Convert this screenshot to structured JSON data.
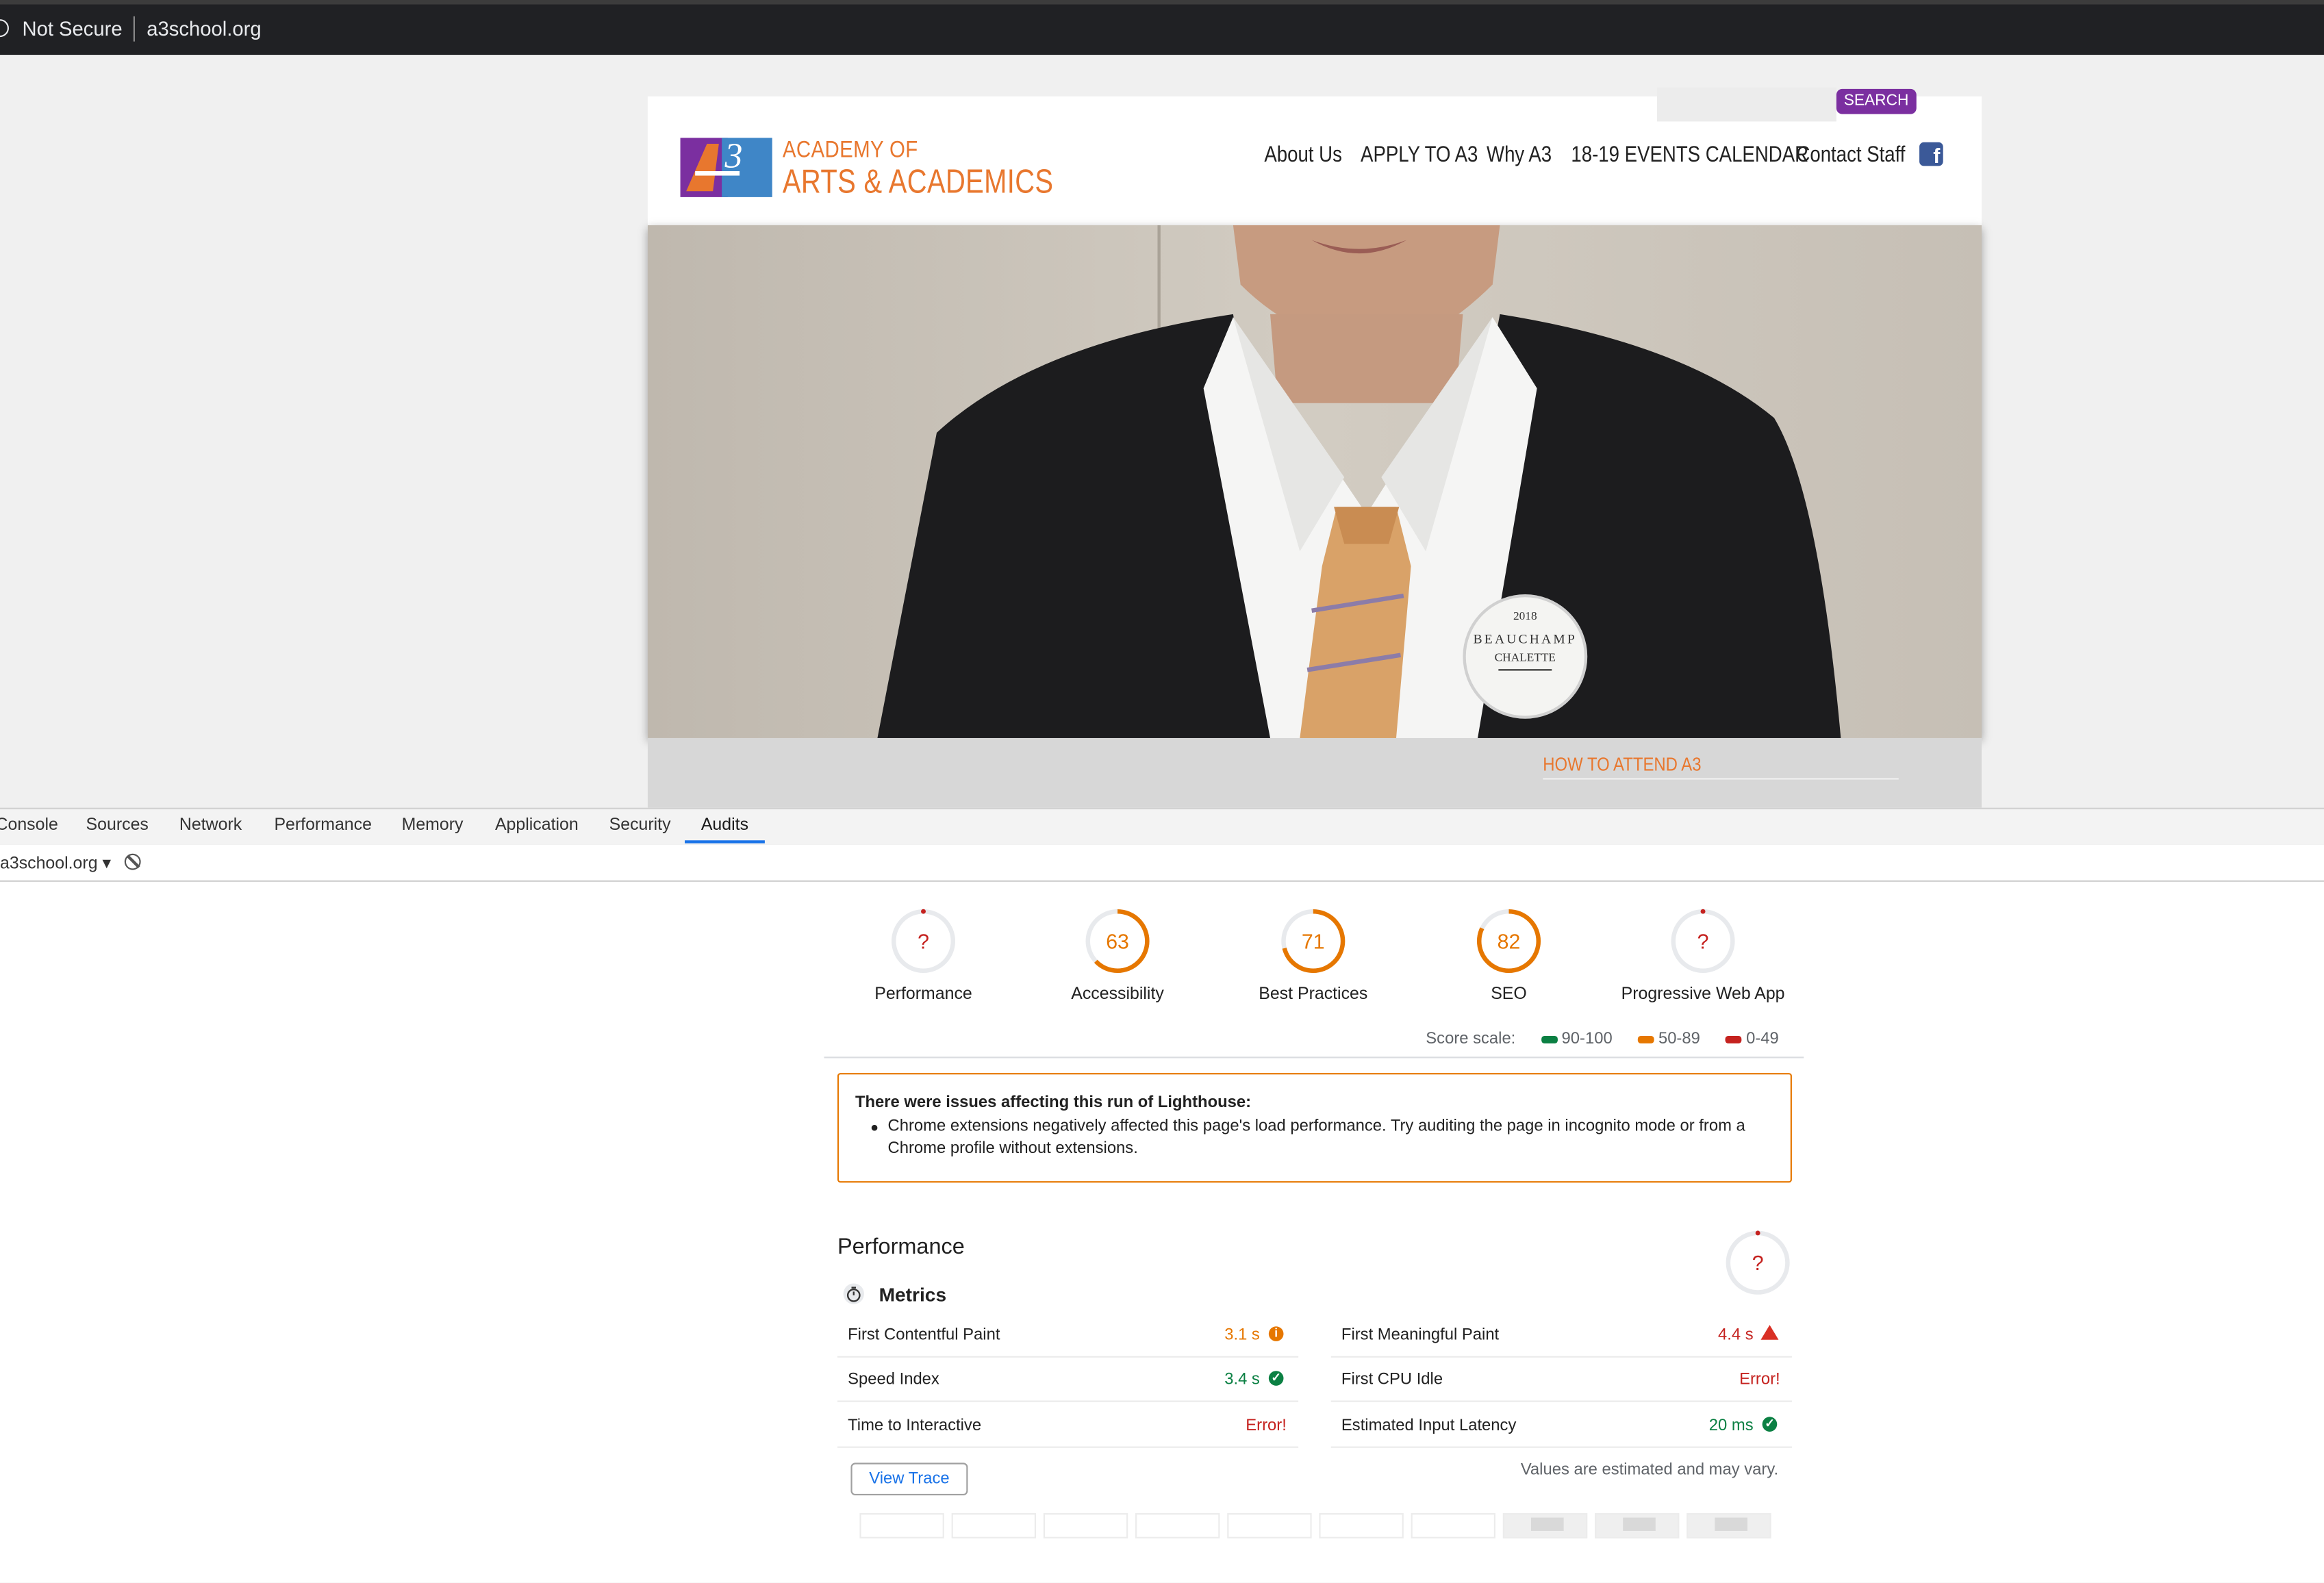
{
  "browser": {
    "security_label": "Not Secure",
    "url": "a3school.org"
  },
  "site": {
    "search_button": "SEARCH",
    "logo_line1": "ACADEMY OF",
    "logo_line2": "ARTS & ACADEMICS",
    "nav": [
      "About Us",
      "APPLY TO A3",
      "Why A3",
      "18-19 EVENTS CALENDAR",
      "Contact Staff"
    ],
    "badge_year": "2018",
    "badge_line1": "BEAUCHAMP",
    "badge_line2": "CHALETTE",
    "how_to_attend": "HOW TO ATTEND A3"
  },
  "devtools": {
    "tabs": [
      "Console",
      "Sources",
      "Network",
      "Performance",
      "Memory",
      "Application",
      "Security",
      "Audits"
    ],
    "active_tab": "Audits",
    "origin": "a3school.org ▾"
  },
  "audit": {
    "categories": [
      {
        "label": "Performance",
        "score": "?",
        "value": null
      },
      {
        "label": "Accessibility",
        "score": "63",
        "value": 63
      },
      {
        "label": "Best Practices",
        "score": "71",
        "value": 71
      },
      {
        "label": "SEO",
        "score": "82",
        "value": 82
      },
      {
        "label": "Progressive Web App",
        "score": "?",
        "value": null
      }
    ],
    "scale_label": "Score scale:",
    "scale": [
      {
        "label": "90-100",
        "color": "#0b8043"
      },
      {
        "label": "50-89",
        "color": "#e67700"
      },
      {
        "label": "0-49",
        "color": "#c5221f"
      }
    ],
    "warning_title": "There were issues affecting this run of Lighthouse:",
    "warning_text": "Chrome extensions negatively affected this page's load performance. Try auditing the page in incognito mode or from a Chrome profile without extensions.",
    "performance_title": "Performance",
    "performance_score": "?",
    "metrics_title": "Metrics",
    "metrics": [
      {
        "name": "First Contentful Paint",
        "value": "3.1 s",
        "status": "average"
      },
      {
        "name": "First Meaningful Paint",
        "value": "4.4 s",
        "status": "fail"
      },
      {
        "name": "Speed Index",
        "value": "3.4 s",
        "status": "pass"
      },
      {
        "name": "First CPU Idle",
        "value": "Error!",
        "status": "error"
      },
      {
        "name": "Time to Interactive",
        "value": "Error!",
        "status": "error"
      },
      {
        "name": "Estimated Input Latency",
        "value": "20 ms",
        "status": "pass"
      }
    ],
    "view_trace": "View Trace",
    "estimated_note": "Values are estimated and may vary."
  },
  "colors": {
    "pass": "#0b8043",
    "average": "#e67700",
    "fail": "#c5221f",
    "accent": "#1a73e8",
    "brand_orange": "#e8772e",
    "brand_purple": "#7b2fa0"
  }
}
